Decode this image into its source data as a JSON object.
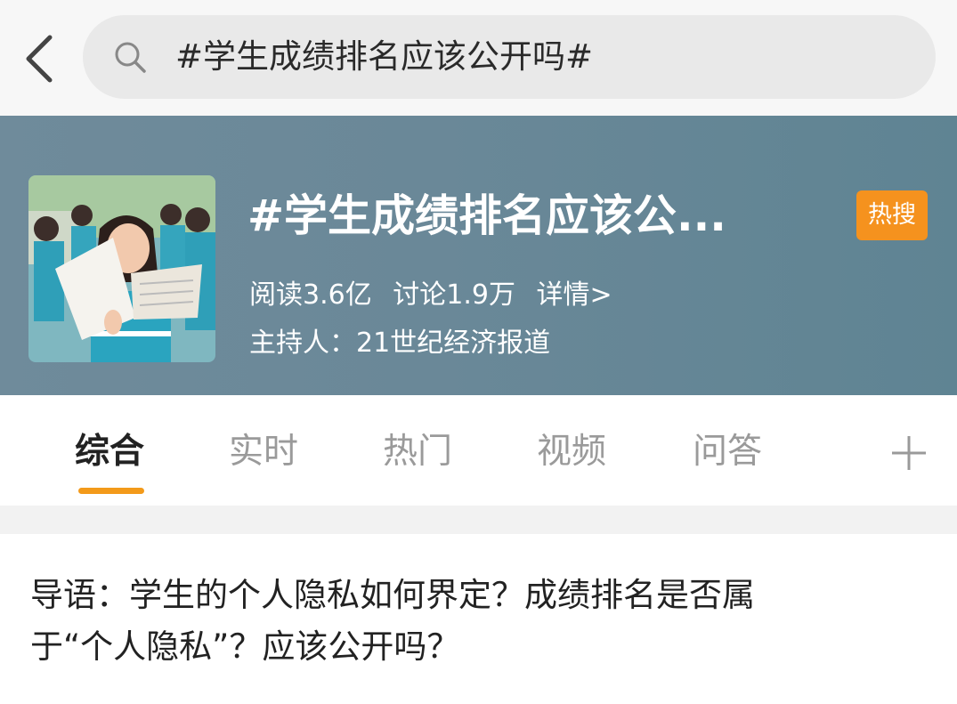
{
  "search": {
    "query": "#学生成绩排名应该公开吗#"
  },
  "topic": {
    "title": "#学生成绩排名应该公...",
    "badge": "热搜",
    "reads": "阅读3.6亿",
    "discussions": "讨论1.9万",
    "details_link": "详情>",
    "host": "主持人：21世纪经济报道"
  },
  "tabs": [
    {
      "label": "综合",
      "active": true
    },
    {
      "label": "实时",
      "active": false
    },
    {
      "label": "热门",
      "active": false
    },
    {
      "label": "视频",
      "active": false
    },
    {
      "label": "问答",
      "active": false
    }
  ],
  "intro": {
    "line1": "导语：学生的个人隐私如何界定？成绩排名是否属",
    "line2": "于“个人隐私”？应该公开吗？"
  },
  "colors": {
    "accent": "#f39a1a",
    "badge": "#f5921e",
    "banner": "#6a8898"
  },
  "icons": {
    "back": "chevron-left-icon",
    "search": "search-icon",
    "more_tabs": "plus-icon"
  }
}
